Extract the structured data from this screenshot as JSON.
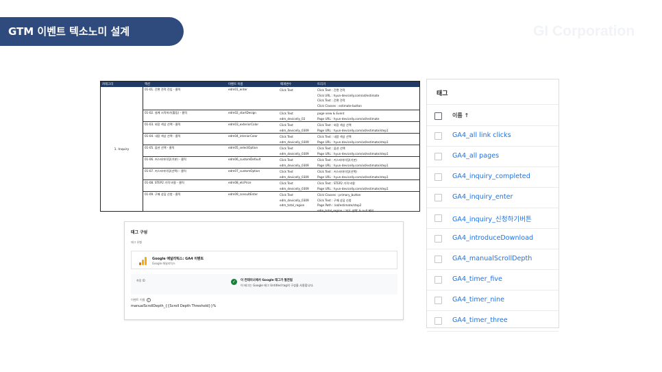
{
  "header": {
    "title": "GTM 이벤트 텍소노미 설계",
    "brand": "GI Corporation"
  },
  "sheet": {
    "columns": [
      "카테고리",
      "액션",
      "이벤트 이름",
      "매개변수",
      "트리거"
    ],
    "category": "1. Inquiry",
    "rows": [
      {
        "action": "01-01. 간편 견적 진입 - 클릭",
        "event": "edm01_enter",
        "vars": [
          "Click Text"
        ],
        "trigger": [
          "Click Text : 간편 견적",
          "Click URL : hyun-devicelly.com/od/estimate",
          "Click Text : 간편 견적",
          "Click Classes : estimate-button"
        ]
      },
      {
        "action": "01-02. 설계 시작하기(툴팁) - 클릭",
        "event": "edm02_startDesign",
        "vars": [
          "Click Text",
          "edm_devicelly_02"
        ],
        "trigger": [
          "page view & Event",
          "Page URL : hyun-devicelly.com/od/estimate"
        ]
      },
      {
        "action": "01-03. 외장 색상 선택 - 클릭",
        "event": "edm03_exteriorColor",
        "vars": [
          "Click Text",
          "edm_devicelly_0309"
        ],
        "trigger": [
          "Click Text : 외장 색상 선택",
          "Page URL : hyun-devicelly.com/od/estimate/step1"
        ]
      },
      {
        "action": "01-04. 내장 색상 선택 - 클릭",
        "event": "edm04_interiorColor",
        "vars": [
          "Click Text",
          "edm_devicelly_0309"
        ],
        "trigger": [
          "Click Text : 내장 색상 선택",
          "Page URL : hyun-devicelly.com/od/estimate/step1"
        ]
      },
      {
        "action": "01-05. 옵션 선택 - 클릭",
        "event": "edm05_selectOption",
        "vars": [
          "Click Text",
          "edm_devicelly_0309"
        ],
        "trigger": [
          "Click Text : 옵션 선택",
          "Page URL : hyun-devicelly.com/od/estimate/step1"
        ]
      },
      {
        "action": "01-06. 커스터마이징(기본) - 클릭",
        "event": "edm06_customDefault",
        "vars": [
          "Click Text",
          "edm_devicelly_0309"
        ],
        "trigger": [
          "Click Text : 커스터마이징(기본)",
          "Page URL : hyun-devicelly.com/od/estimate/step1"
        ]
      },
      {
        "action": "01-07. 커스터마이징(선택) - 클릭",
        "event": "edm07_customOption",
        "vars": [
          "Click Text",
          "edm_devicelly_0309"
        ],
        "trigger": [
          "Click Text : 커스터마이징(선택)",
          "Page URL : hyun-devicelly.com/od/estimate/step1"
        ]
      },
      {
        "action": "01-08. STEP2 가격 비용 - 클릭",
        "event": "edm08_etcPrice",
        "vars": [
          "Click Text",
          "edm_devicelly_0309"
        ],
        "trigger": [
          "Click Text : STEP2 가격 비용",
          "Page URL : hyun-devicelly.com/od/estimate/step1"
        ]
      },
      {
        "action": "01-09. 구매 상담 신청 - 클릭",
        "event": "edm09_consultEnter",
        "vars": [
          "Click Text",
          "edm_devicelly_0309",
          "edm_total_region"
        ],
        "trigger": [
          "Click Classes : primary_button",
          "Click Text : 구매 상담 신청",
          "Page Path : /od/estimate/step2",
          "edm_total_region : '지도 선택' & null 제외"
        ]
      }
    ]
  },
  "config": {
    "title": "태그 구성",
    "type_label": "태그 유형",
    "type_name": "Google 애널리틱스: GA4 이벤트",
    "type_sub": "Google 애널리틱스",
    "measure_label": "측정 ID",
    "found_title": "이 컨테이너에서 Google 태그가 발견됨",
    "found_sub": "이 태그는 Google 태그 Untitled tag의 구성을 사용합니다.",
    "event_name_label": "이벤트 이름",
    "event_name": "manualScrollDepth_{{Scroll Depth Threshold}}%"
  },
  "taglist": {
    "title": "태그",
    "column": "이름 ↑",
    "items": [
      "GA4_all link clicks",
      "GA4_all pages",
      "GA4_inquiry_completed",
      "GA4_inquiry_enter",
      "GA4_inquiry_신청하기버튼",
      "GA4_introduceDownload",
      "GA4_manualScrollDepth",
      "GA4_timer_five",
      "GA4_timer_nine",
      "GA4_timer_three"
    ]
  },
  "colors": {
    "header_bg": "#2f4a7c",
    "link": "#1a73e8",
    "success": "#188038"
  },
  "icons": {
    "chart": "ga-analytics-icon",
    "check": "check-circle-icon",
    "help": "help-icon"
  }
}
